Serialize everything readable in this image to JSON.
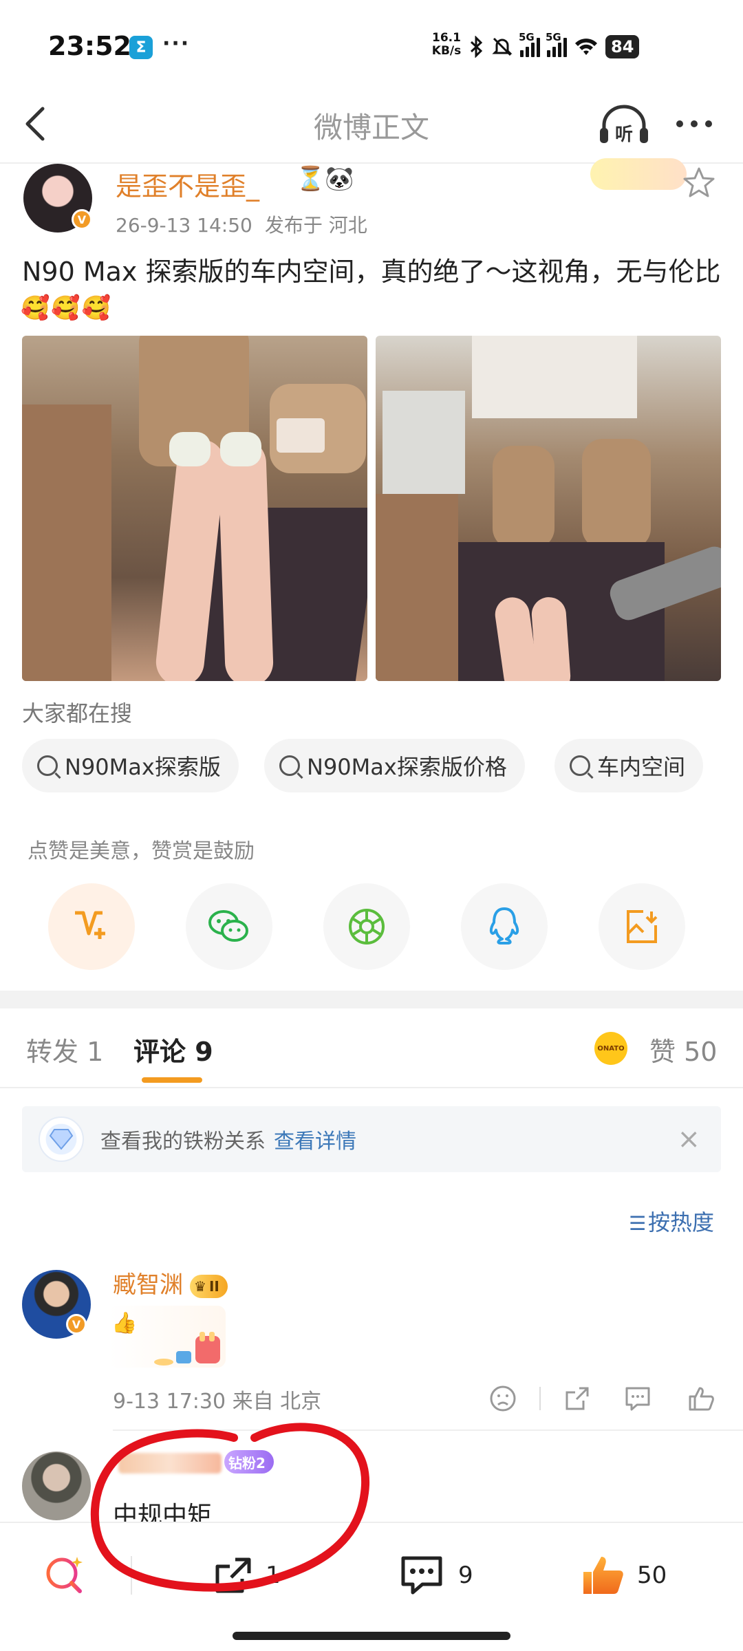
{
  "status_bar": {
    "time": "23:52",
    "app_icon_letter": "Σ",
    "notification_dots": "···",
    "net_speed_value": "16.1",
    "net_speed_unit": "KB/s",
    "signal1_label": "5G",
    "signal2_label": "5G",
    "battery": "84"
  },
  "header": {
    "title": "微博正文",
    "listen_label": "听"
  },
  "post": {
    "author": "是歪不是歪_",
    "author_emoji": "⏳🐼",
    "date": "26-9-13 14:50",
    "location": "发布于 河北",
    "text": "N90 Max 探索版的车内空间，真的绝了～这视角，无与伦比",
    "emojis": "🥰🥰🥰"
  },
  "search": {
    "title": "大家都在搜",
    "chips": [
      "N90Max探索版",
      "N90Max探索版价格",
      "车内空间"
    ]
  },
  "encourage_text": "点赞是美意，赞赏是鼓励",
  "share_icons": [
    "reward-icon",
    "wechat-icon",
    "moments-icon",
    "qq-icon",
    "save-image-icon"
  ],
  "tabs": {
    "repost": "转发 1",
    "comments": "评论 9",
    "likes": "赞 50",
    "like_badge": "ONATO"
  },
  "fan_banner": {
    "text": "查看我的铁粉关系",
    "link": "查看详情",
    "close": "×"
  },
  "sort": {
    "label": "按热度"
  },
  "comments": [
    {
      "name": "臧智渊",
      "badge": "II",
      "content_emoji": "👍",
      "time": "9-13 17:30",
      "source": "来自 北京"
    },
    {
      "badge": "钻粉2",
      "text": "中规中矩"
    }
  ],
  "bottom_bar": {
    "repost_count": "1",
    "comment_count": "9",
    "like_count": "50"
  },
  "colors": {
    "accent_orange": "#f39b20",
    "author_orange": "#e0802a",
    "link_blue": "#3c78b8",
    "annotation_red": "#e3121c"
  }
}
